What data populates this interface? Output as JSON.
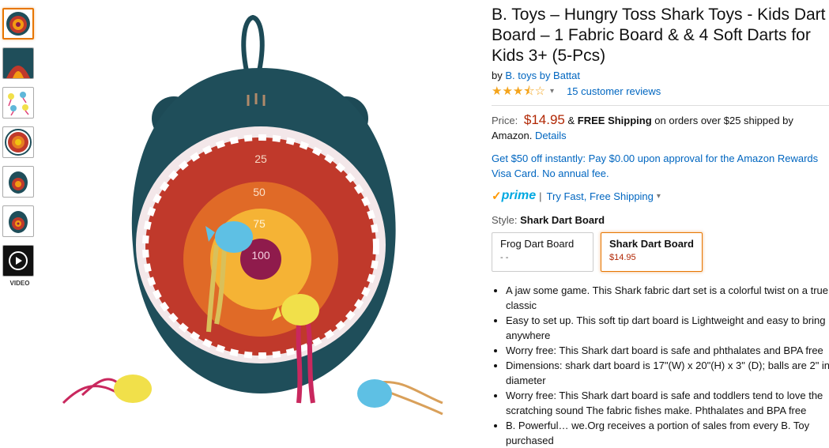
{
  "thumbnails": [
    {
      "name": "thumb-1",
      "active": true
    },
    {
      "name": "thumb-2",
      "active": false
    },
    {
      "name": "thumb-3",
      "active": false
    },
    {
      "name": "thumb-4",
      "active": false
    },
    {
      "name": "thumb-5",
      "active": false
    },
    {
      "name": "thumb-6",
      "active": false
    }
  ],
  "video_label": "VIDEO",
  "target_scores": [
    "25",
    "50",
    "75",
    "100"
  ],
  "product": {
    "title": "B. Toys – Hungry Toss Shark Toys - Kids Dart Board – 1 Fabric Board & & 4 Soft Darts for Kids 3+ (5-Pcs)",
    "by_prefix": "by",
    "brand": "B. toys by Battat",
    "rating_stars": 3.5,
    "reviews": "15 customer reviews"
  },
  "price": {
    "label": "Price:",
    "amount": "$14.95",
    "shipping_amp": "&",
    "free_shipping": "FREE Shipping",
    "shipping_rest": "on orders over $25 shipped by Amazon.",
    "details": "Details"
  },
  "promo": "Get $50 off instantly: Pay $0.00 upon approval for the Amazon Rewards Visa Card. No annual fee.",
  "prime": {
    "check": "✓",
    "word": "prime",
    "sep": "|",
    "cta": "Try Fast, Free Shipping"
  },
  "style": {
    "label": "Style:",
    "value": "Shark Dart Board",
    "options": [
      {
        "name": "Frog Dart Board",
        "price": "- -",
        "selected": false
      },
      {
        "name": "Shark Dart Board",
        "price": "$14.95",
        "selected": true
      }
    ]
  },
  "bullets": [
    "A jaw some game. This Shark fabric dart set is a colorful twist on a true classic",
    "Easy to set up. This soft tip dart board is Lightweight and easy to bring anywhere",
    "Worry free: This Shark dart board is safe and phthalates and BPA free",
    "Dimensions: shark dart board is 17\"(W) x 20\"(H) x 3\" (D); balls are 2\" in diameter",
    "Worry free: This Shark dart board is safe and toddlers tend to love the scratching sound The fabric fishes make. Phthalates and BPA free",
    "B. Powerful… we.Org receives a portion of sales from every B. Toy purchased"
  ],
  "colors": {
    "accent": "#e77600",
    "link": "#0066c0",
    "price": "#b12704",
    "star": "#f4a41c",
    "prime": "#00a8e1"
  }
}
